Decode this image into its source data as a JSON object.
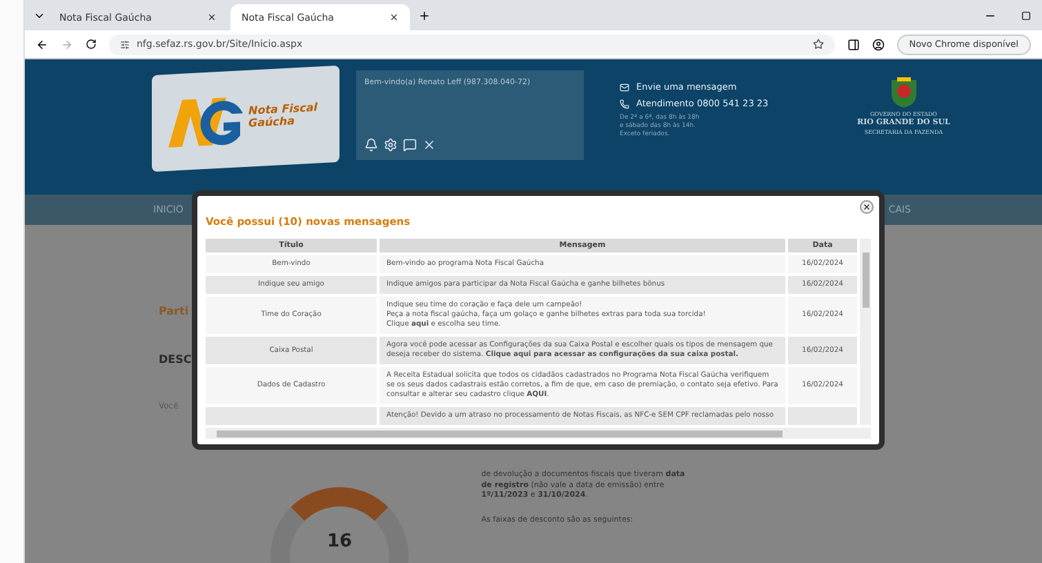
{
  "browser": {
    "tabs": [
      {
        "label": "Nota Fiscal Gaúcha",
        "selected": false
      },
      {
        "label": "Nota Fiscal Gaúcha",
        "selected": true
      }
    ],
    "url": "nfg.sefaz.rs.gov.br/Site/Inicio.aspx",
    "update_button": "Novo Chrome disponível"
  },
  "header": {
    "logo_text": "Nota Fiscal",
    "logo_subtext": "Gaúcha",
    "welcome": "Bem-vindo(a) Renato Leff (987.308.040-72)",
    "contact": [
      {
        "kind": "mail",
        "label": "Envie uma mensagem"
      },
      {
        "kind": "phone",
        "label": "Atendimento 0800 541 23 23"
      }
    ],
    "hours": "De 2ª a 6ª, das 8h às 18h\ne sábado das 8h às 14h.\nExceto feriados.",
    "gov": [
      "GOVERNO DO ESTADO",
      "RIO GRANDE DO SUL",
      "SECRETARIA DA FAZENDA"
    ]
  },
  "nav": {
    "left": "INICIO",
    "right": "CAIS"
  },
  "content": {
    "left_items": [
      {
        "kind": "title",
        "text": "Parti"
      },
      {
        "kind": "heading",
        "text": "DESC"
      },
      {
        "kind": "text",
        "text": "Você"
      }
    ],
    "paragraphs": [
      "de devolução a documentos fiscais que tiveram **data de registro** (não vale a data de emissão) entre **1º/11/2023** e **31/10/2024**.",
      "As faixas de desconto são as seguintes:"
    ],
    "donut_value": "16"
  },
  "modal": {
    "title": "Você possui (10) novas mensagens",
    "columns": [
      "Título",
      "Mensagem",
      "Data"
    ],
    "rows": [
      {
        "title": "Bem-vindo",
        "message": [
          "Bem-vindo ao programa Nota Fiscal Gaúcha"
        ],
        "date": "16/02/2024"
      },
      {
        "title": "Indique seu amigo",
        "message": [
          "Indique amigos para participar da Nota Fiscal Gaúcha e ganhe bilhetes bônus"
        ],
        "date": "16/02/2024"
      },
      {
        "title": "Time do Coração",
        "message": [
          "Indique seu time do coração e faça dele um campeão!",
          "Peça a nota fiscal gaúcha, faça um golaço e ganhe bilhetes extras para toda sua torcida!",
          "Clique **aqui** e escolha seu time."
        ],
        "date": "16/02/2024"
      },
      {
        "title": "Caixa Postal",
        "message": [
          "Agora você pode acessar as Configurações da sua Caixa Postal e escolher quais os tipos de mensagem que deseja receber do sistema. **Clique aqui para acessar as configurações da sua caixa postal.**"
        ],
        "date": "16/02/2024"
      },
      {
        "title": "Dados de Cadastro",
        "message": [
          "A Receita Estadual solicita que todos os cidadãos cadastrados no Programa Nota Fiscal Gaúcha verifiquem se os seus dados cadastrais estão corretos, a fim de que, em caso de premiação, o contato seja efetivo. Para consultar e alterar seu cadastro clique **AQUI**."
        ],
        "date": "16/02/2024"
      },
      {
        "title": "",
        "message": [
          "Atenção! Devido a um atraso no processamento de Notas Fiscais, as NFC-e SEM CPF reclamadas pelo nosso"
        ],
        "date": ""
      }
    ]
  }
}
